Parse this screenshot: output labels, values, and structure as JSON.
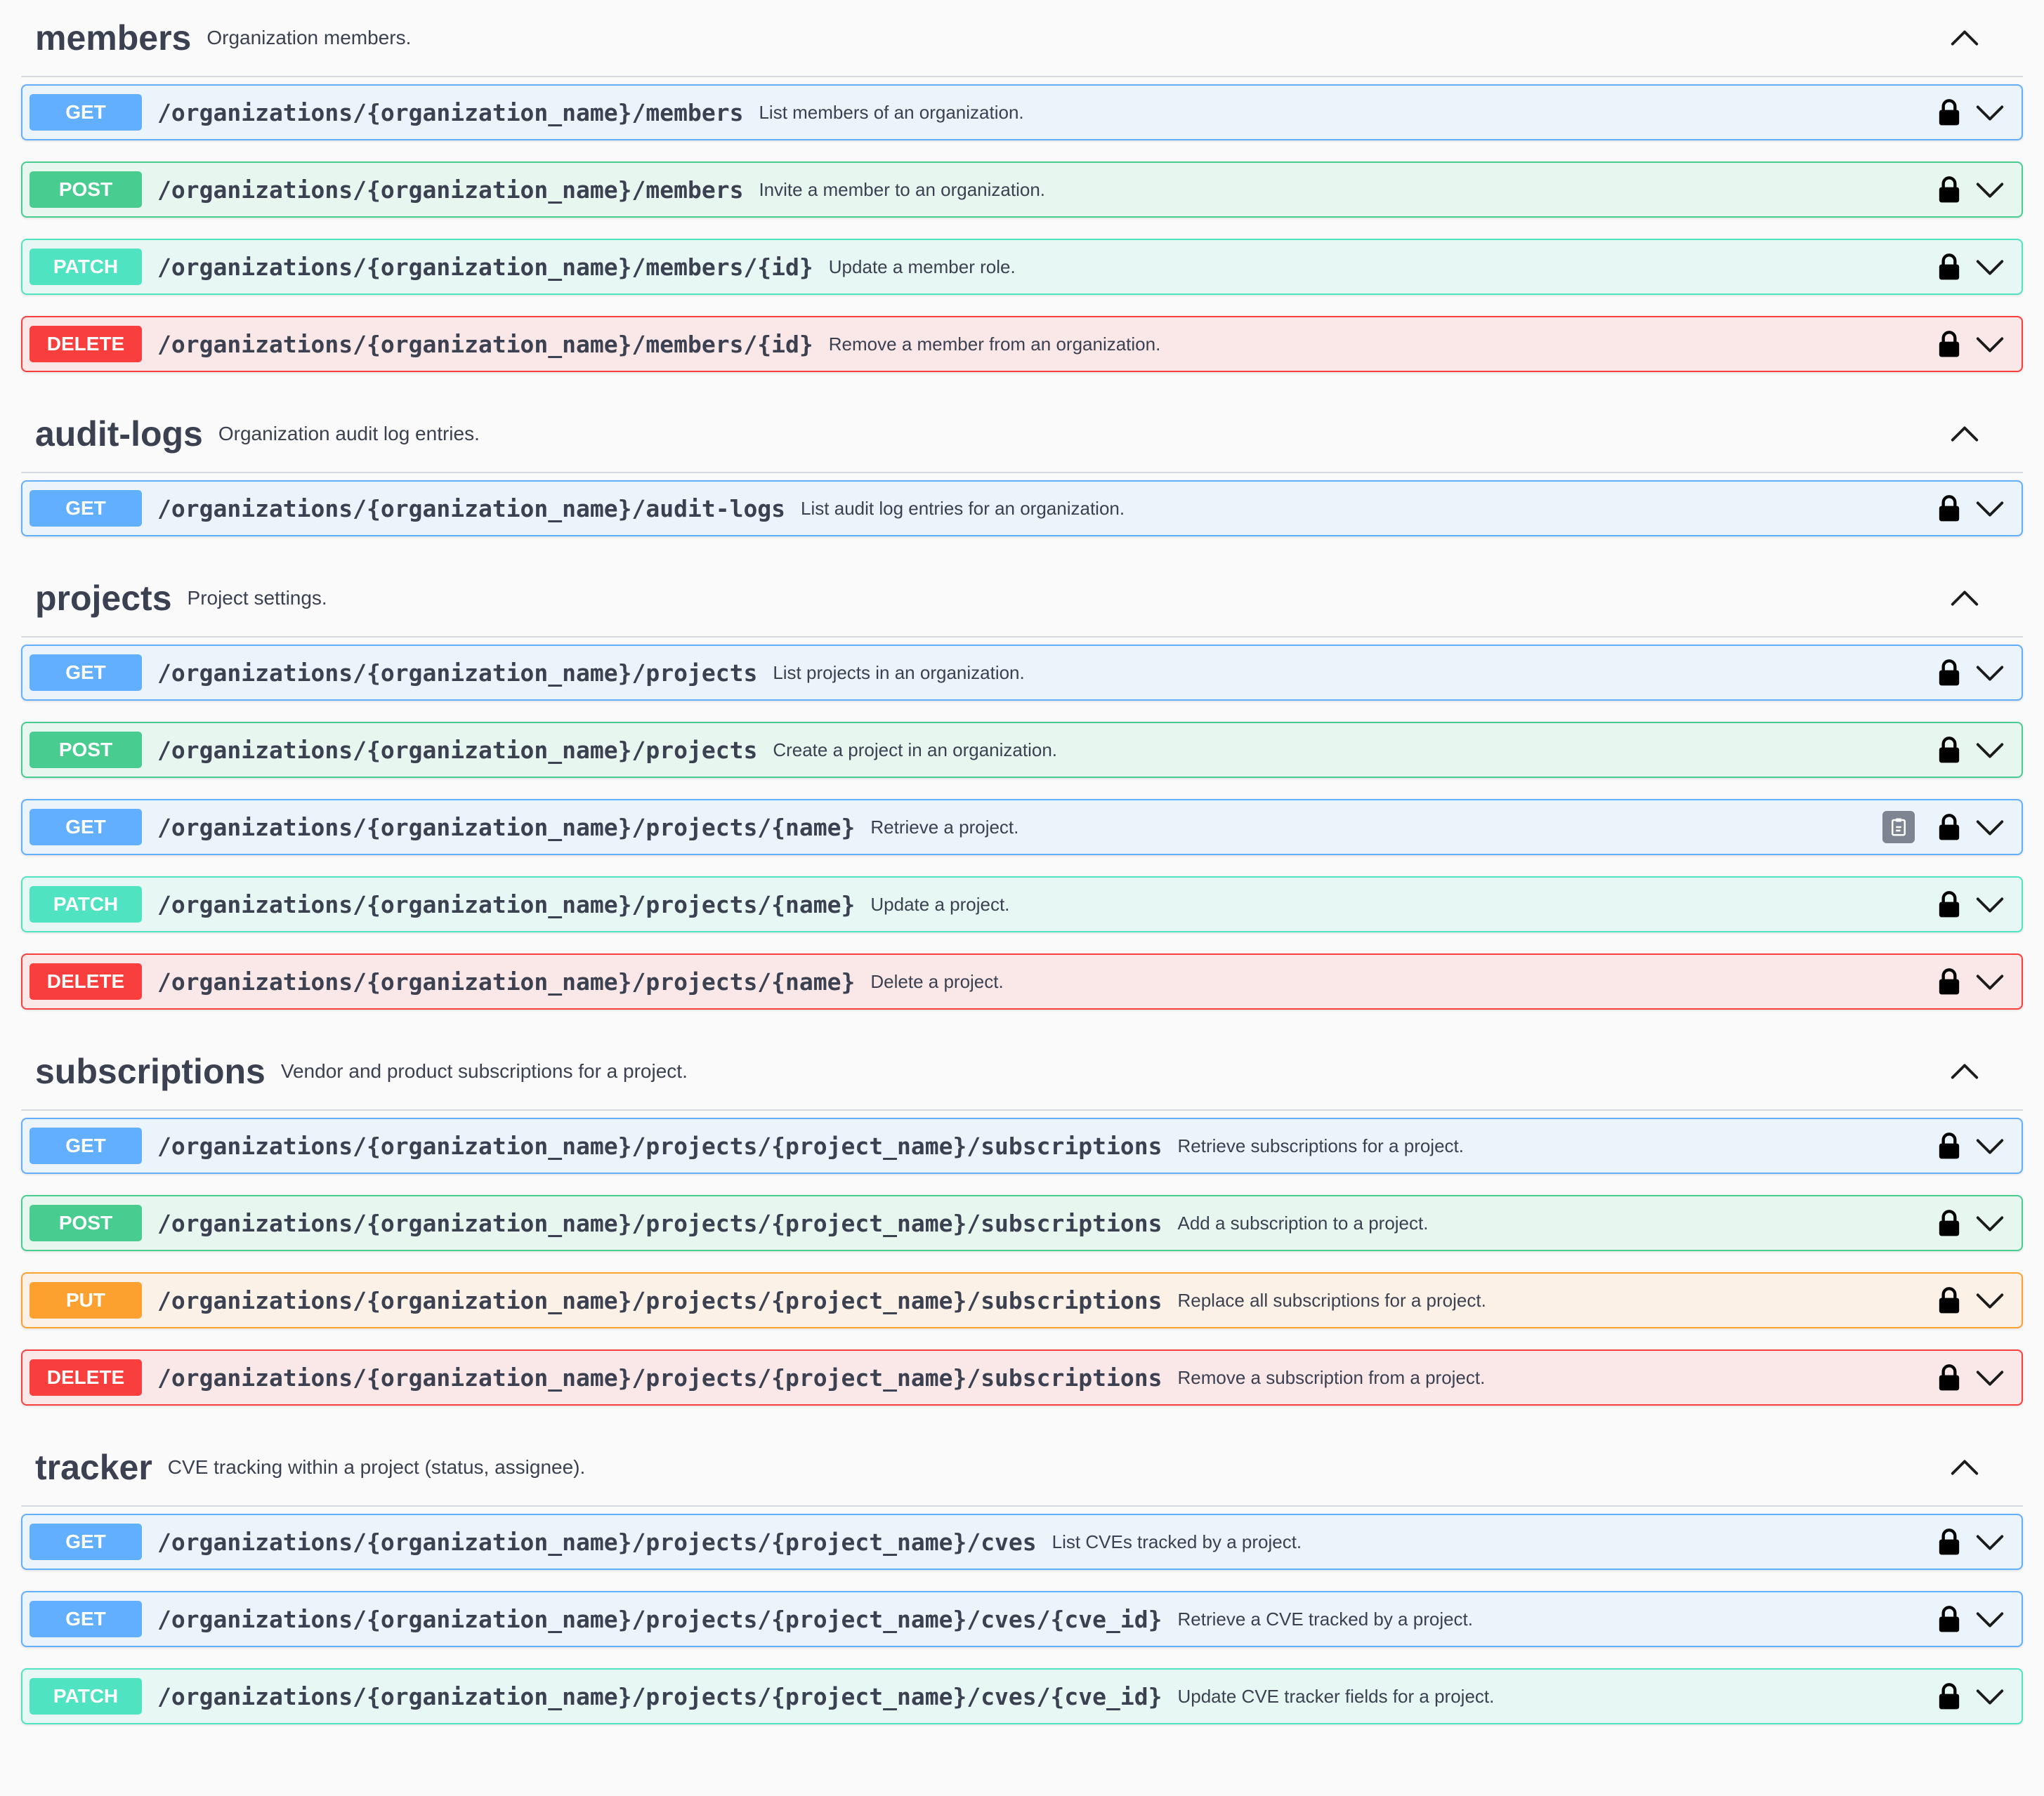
{
  "sections": [
    {
      "name": "members",
      "description": "Organization members.",
      "operations": [
        {
          "method": "GET",
          "path": "/organizations/{organization_name}/members",
          "summary": "List members of an organization."
        },
        {
          "method": "POST",
          "path": "/organizations/{organization_name}/members",
          "summary": "Invite a member to an organization."
        },
        {
          "method": "PATCH",
          "path": "/organizations/{organization_name}/members/{id}",
          "summary": "Update a member role."
        },
        {
          "method": "DELETE",
          "path": "/organizations/{organization_name}/members/{id}",
          "summary": "Remove a member from an organization."
        }
      ]
    },
    {
      "name": "audit-logs",
      "description": "Organization audit log entries.",
      "operations": [
        {
          "method": "GET",
          "path": "/organizations/{organization_name}/audit-logs",
          "summary": "List audit log entries for an organization."
        }
      ]
    },
    {
      "name": "projects",
      "description": "Project settings.",
      "operations": [
        {
          "method": "GET",
          "path": "/organizations/{organization_name}/projects",
          "summary": "List projects in an organization."
        },
        {
          "method": "POST",
          "path": "/organizations/{organization_name}/projects",
          "summary": "Create a project in an organization."
        },
        {
          "method": "GET",
          "path": "/organizations/{organization_name}/projects/{name}",
          "summary": "Retrieve a project.",
          "copy_button": true
        },
        {
          "method": "PATCH",
          "path": "/organizations/{organization_name}/projects/{name}",
          "summary": "Update a project."
        },
        {
          "method": "DELETE",
          "path": "/organizations/{organization_name}/projects/{name}",
          "summary": "Delete a project."
        }
      ]
    },
    {
      "name": "subscriptions",
      "description": "Vendor and product subscriptions for a project.",
      "operations": [
        {
          "method": "GET",
          "path": "/organizations/{organization_name}/projects/{project_name}/subscriptions",
          "summary": "Retrieve subscriptions for a project."
        },
        {
          "method": "POST",
          "path": "/organizations/{organization_name}/projects/{project_name}/subscriptions",
          "summary": "Add a subscription to a project."
        },
        {
          "method": "PUT",
          "path": "/organizations/{organization_name}/projects/{project_name}/subscriptions",
          "summary": "Replace all subscriptions for a project."
        },
        {
          "method": "DELETE",
          "path": "/organizations/{organization_name}/projects/{project_name}/subscriptions",
          "summary": "Remove a subscription from a project."
        }
      ]
    },
    {
      "name": "tracker",
      "description": "CVE tracking within a project (status, assignee).",
      "operations": [
        {
          "method": "GET",
          "path": "/organizations/{organization_name}/projects/{project_name}/cves",
          "summary": "List CVEs tracked by a project."
        },
        {
          "method": "GET",
          "path": "/organizations/{organization_name}/projects/{project_name}/cves/{cve_id}",
          "summary": "Retrieve a CVE tracked by a project."
        },
        {
          "method": "PATCH",
          "path": "/organizations/{organization_name}/projects/{project_name}/cves/{cve_id}",
          "summary": "Update CVE tracker fields for a project."
        }
      ]
    }
  ],
  "icons": {
    "section_toggle": "chevron-up-icon",
    "auth": "lock-icon",
    "expand": "chevron-down-icon",
    "copy": "clipboard-copy-icon"
  },
  "colors": {
    "GET": "#61affe",
    "POST": "#49cc90",
    "PATCH": "#50e3c2",
    "DELETE": "#f93e3e",
    "PUT": "#fca130"
  }
}
